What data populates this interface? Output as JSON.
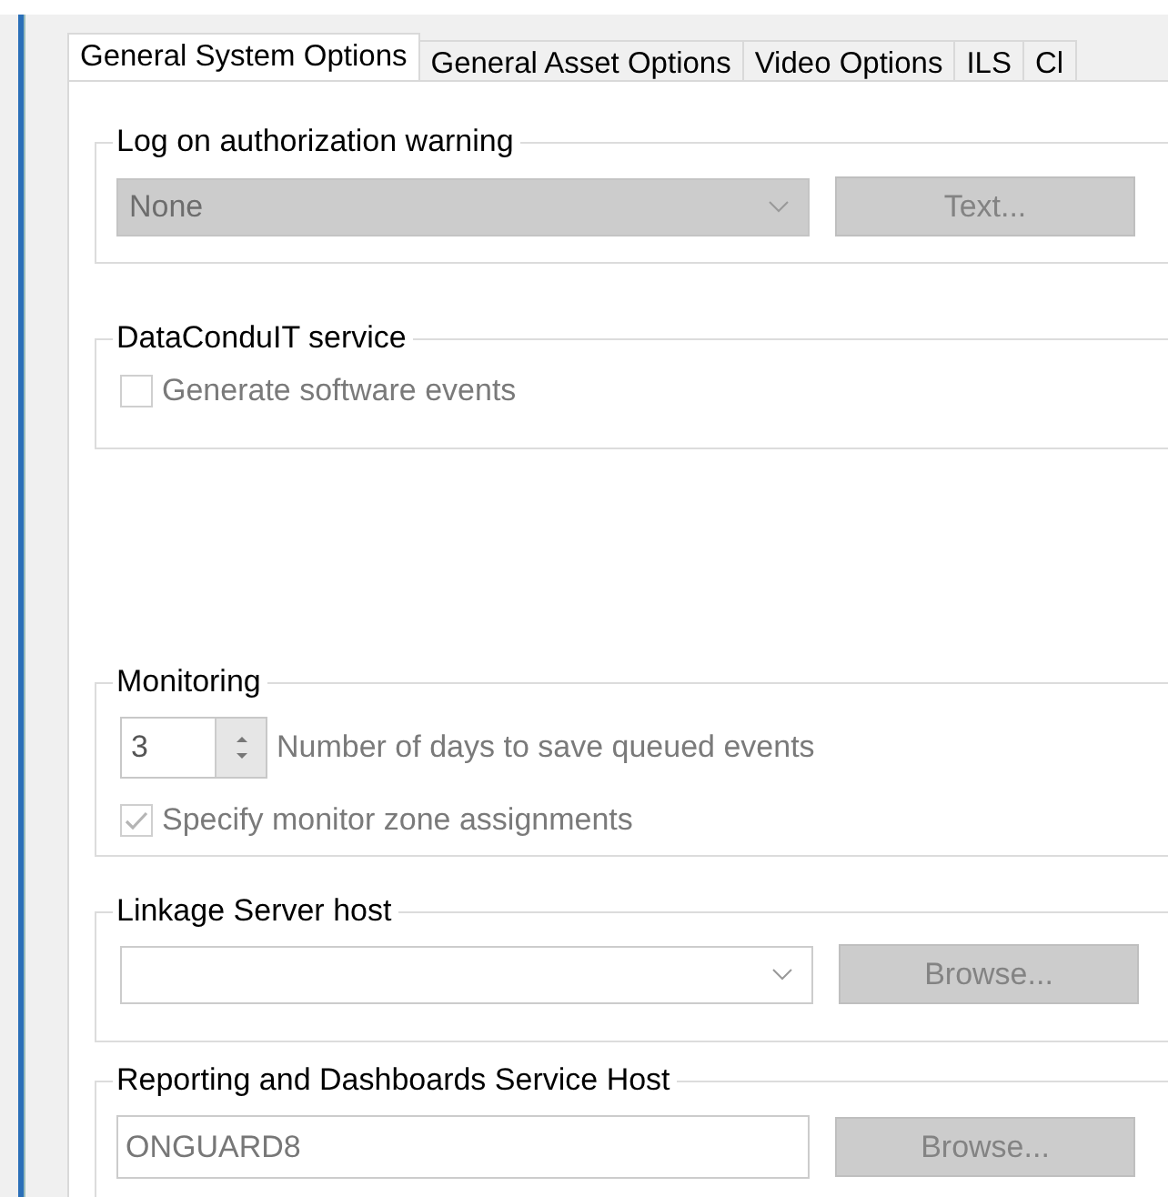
{
  "tabs": [
    {
      "label": "General System Options",
      "selected": true
    },
    {
      "label": "General Asset Options",
      "selected": false
    },
    {
      "label": "Video Options",
      "selected": false
    },
    {
      "label": "ILS",
      "selected": false
    },
    {
      "label": "Cl",
      "selected": false
    }
  ],
  "groups": [
    {
      "title": "Log on authorization warning",
      "rows": [
        {
          "kind": "dropdown",
          "value": "None",
          "disabled": true,
          "button": {
            "label": "Text...",
            "disabled": true
          }
        }
      ]
    },
    {
      "title": "DataConduIT service",
      "rows": [
        {
          "kind": "checkbox",
          "label": "Generate software events",
          "checked": false,
          "disabled": true
        }
      ]
    },
    {
      "title": "Monitoring",
      "rows": [
        {
          "kind": "spin",
          "value": "3",
          "caption": "Number of days to save queued events",
          "disabled": true
        },
        {
          "kind": "checkbox",
          "label": "Specify monitor zone assignments",
          "checked": true,
          "disabled": true
        }
      ]
    },
    {
      "title": "Linkage Server host",
      "rows": [
        {
          "kind": "dropdown",
          "disabled": false,
          "button": {
            "label": "Browse...",
            "disabled": true
          }
        }
      ]
    },
    {
      "title": "Reporting and Dashboards Service Host",
      "rows": [
        {
          "kind": "textfield",
          "value": "ONGUARD8",
          "disabled": true,
          "button": {
            "label": "Browse...",
            "disabled": true
          }
        }
      ]
    }
  ]
}
